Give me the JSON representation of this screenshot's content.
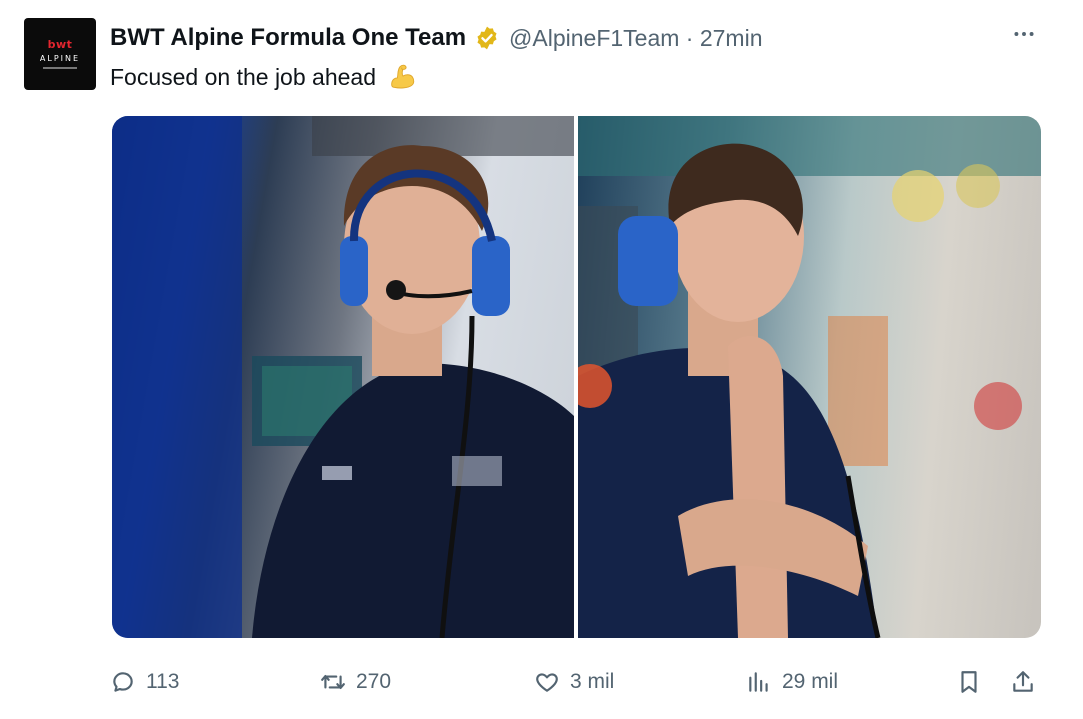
{
  "account": {
    "avatar_line1": "bwt",
    "avatar_line2": "ALPINE",
    "display_name": "BWT Alpine Formula One Team",
    "verified_icon": "verified-badge-icon",
    "handle_time": "@AlpineF1Team · 27min"
  },
  "tweet": {
    "text": "Focused on the job ahead",
    "emoji_icon": "flexed-biceps-icon"
  },
  "media": {
    "photos": [
      {
        "name": "photo-driver-with-headset-mic"
      },
      {
        "name": "photo-driver-thinking"
      }
    ]
  },
  "actions": {
    "replies": "113",
    "reposts": "270",
    "likes": "3 mil",
    "views": "29 mil"
  },
  "menu": {
    "more_icon": "more-options-icon"
  },
  "colors": {
    "text_primary": "#0f1419",
    "text_secondary": "#536471",
    "verified_gold": "#e2b719",
    "avatar_red": "#e3262f"
  }
}
